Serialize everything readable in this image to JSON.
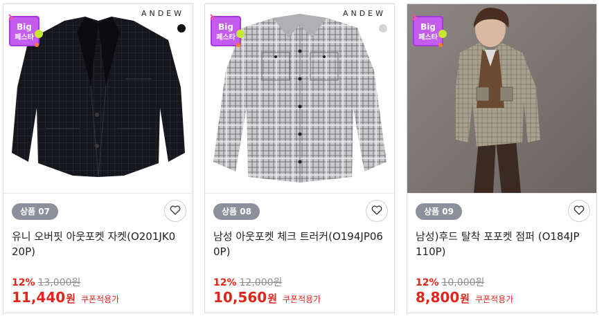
{
  "badge": {
    "line1": "Big",
    "line2": "페스타"
  },
  "products": [
    {
      "brand": "ANDEW",
      "swatch_color": "#111111",
      "number_label": "상품 07",
      "name": "유니 오버핏 아웃포켓 자켓(O201JK020P)",
      "discount": "12%",
      "original_price": "13,000원",
      "final_amount": "11,440",
      "final_unit": "원",
      "coupon_text": "쿠폰적용가",
      "image": "black-overcoat-jacket"
    },
    {
      "brand": "ANDEW",
      "swatch_color": "#d4d4d8",
      "number_label": "상품 08",
      "name": "남성 아웃포켓 체크 트러커(O194JP060P)",
      "discount": "12%",
      "original_price": "12,000원",
      "final_amount": "10,560",
      "final_unit": "원",
      "coupon_text": "쿠폰적용가",
      "image": "grey-check-trucker-jacket"
    },
    {
      "brand": "",
      "swatch_color": "",
      "number_label": "상품 09",
      "name": "남성)후드 탈착 포포켓 점퍼 (O184JP110P)",
      "discount": "12%",
      "original_price": "10,000원",
      "final_amount": "8,800",
      "final_unit": "원",
      "coupon_text": "쿠폰적용가",
      "image": "model-wearing-beige-check-jumper"
    }
  ],
  "icons": {
    "wishlist": "heart-icon",
    "event": "big-festa-badge-icon"
  }
}
